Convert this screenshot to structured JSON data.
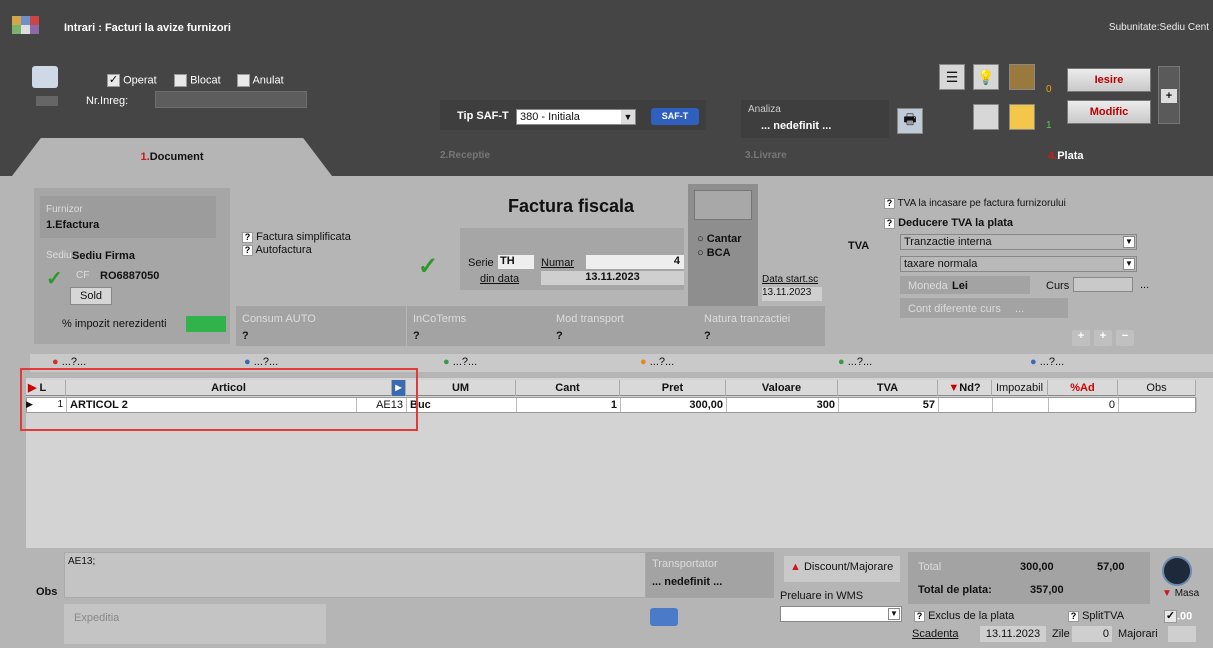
{
  "window": {
    "title": "Intrari : Facturi la avize furnizori",
    "subunit": "Subunitate:Sediu Cent"
  },
  "header": {
    "operat": "Operat",
    "operat_checked": true,
    "blocat": "Blocat",
    "anulat": "Anulat",
    "nr_inreg_label": "Nr.Inreg:",
    "tip_saft_label": "Tip SAF-T",
    "tip_saft_value": "380 - Initiala",
    "saft_badge": "SAF-T",
    "analiza_label": "Analiza",
    "analiza_value": "... nedefinit ...",
    "counter_zero": "0",
    "counter_one": "1",
    "iesire": "Iesire",
    "modific": "Modific"
  },
  "tabs": {
    "document": "Document",
    "document_num": "1.",
    "receptie": "2.Receptie",
    "livrare": "3.Livrare",
    "plata": "Plata",
    "plata_num": "4."
  },
  "document": {
    "furnizor_label": "Furnizor",
    "furnizor_value": "1.Efactura",
    "sediu_label": "Sediu",
    "sediu_value": "Sediu Firma",
    "cf_label": "CF",
    "cf_value": "RO6887050",
    "sold_button": "Sold",
    "impozit_label": "% impozit nerezidenti",
    "factura_simplificata": "Factura simplificata",
    "autofactura": "Autofactura",
    "consum_label": "Consum AUTO",
    "consum_value": "?",
    "doc_title": "Factura fiscala",
    "serie_label": "Serie",
    "serie_value": "TH",
    "numar_label": "Numar",
    "numar_value": "4",
    "din_data_label": "din data",
    "din_data_value": "13.11.2023",
    "cantar": "Cantar",
    "bca": "BCA",
    "data_start_label": "Data start.sc",
    "data_start_value": "13.11.2023",
    "incoterms_label": "InCoTerms",
    "incoterms_value": "?",
    "mod_transport_label": "Mod transport",
    "mod_transport_value": "?",
    "natura_label": "Natura tranzactiei",
    "natura_value": "?",
    "tva_incasare": "TVA la incasare pe factura furnizorului",
    "deducere_tva": "Deducere TVA la plata",
    "tva_label": "TVA",
    "tranzactie_value": "Tranzactie interna",
    "taxare_value": "taxare normala",
    "moneda_label": "Moneda",
    "moneda_value": "Lei",
    "curs_label": "Curs",
    "cont_diferente": "Cont diferente curs",
    "ellipsis": "...",
    "q": "?"
  },
  "filters": [
    "...?...",
    "...?...",
    "...?...",
    "...?...",
    "...?...",
    "...?..."
  ],
  "grid": {
    "columns": [
      "L",
      "Articol",
      "UM",
      "Cant",
      "Pret",
      "Valoare",
      "TVA",
      "Nd?",
      "Impozabil",
      "%Ad",
      "Obs"
    ],
    "rows": [
      {
        "line": "1",
        "articol": "ARTICOL 2",
        "cod": "AE13",
        "um": "Buc",
        "cant": "1",
        "pret": "300,00",
        "valoare": "300",
        "tva": "57",
        "nd": "",
        "impozabil": "",
        "ad": "0",
        "obs": ""
      }
    ]
  },
  "bottom": {
    "obs_label": "Obs",
    "obs_value": "AE13;",
    "expeditia": "Expeditia",
    "transportator_label": "Transportator",
    "transportator_value": "... nedefinit ...",
    "discount": "Discount/Majorare",
    "preluare_wms": "Preluare in WMS",
    "total_label": "Total",
    "total_value": "300,00",
    "total_tva": "57,00",
    "total_plata_label": "Total de plata:",
    "total_plata_value": "357,00",
    "masa": "Masa",
    "exclus_plata": "Exclus de la plata",
    "split_tva": "SplitTVA",
    "zero": ".00",
    "scadenta_label": "Scadenta",
    "scadenta_value": "13.11.2023",
    "zile_label": "Zile",
    "zile_value": "0",
    "majorari_label": "Majorari"
  },
  "colors": {
    "dark": "#454545",
    "panel": "#b5b5b5",
    "highlight_red": "#e03a3a",
    "accent_green": "#2fb34a"
  }
}
